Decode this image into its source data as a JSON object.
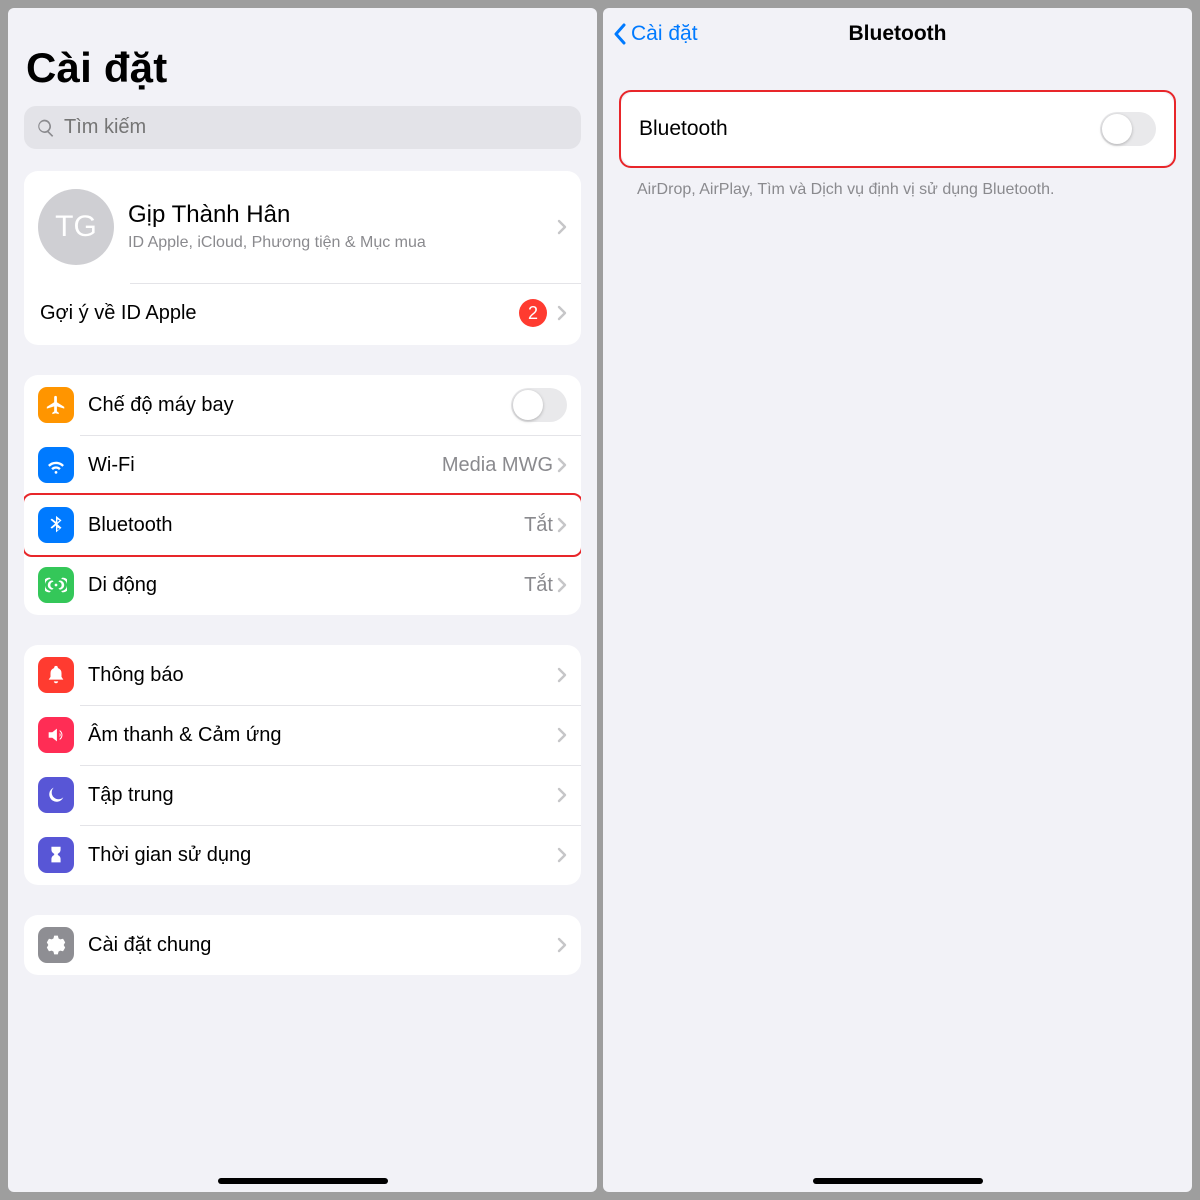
{
  "left": {
    "title": "Cài đặt",
    "search_placeholder": "Tìm kiếm",
    "profile": {
      "initials": "TG",
      "name": "Gịp Thành Hân",
      "subtitle": "ID Apple, iCloud, Phương tiện & Mục mua"
    },
    "suggestion": {
      "label": "Gợi ý về ID Apple",
      "badge": "2"
    },
    "group1": {
      "airplane": "Chế độ máy bay",
      "wifi_label": "Wi-Fi",
      "wifi_value": "Media MWG",
      "bluetooth_label": "Bluetooth",
      "bluetooth_value": "Tắt",
      "cellular_label": "Di động",
      "cellular_value": "Tắt"
    },
    "group2": {
      "notifications": "Thông báo",
      "sounds": "Âm thanh & Cảm ứng",
      "focus": "Tập trung",
      "screentime": "Thời gian sử dụng"
    },
    "group3": {
      "general": "Cài đặt chung"
    }
  },
  "right": {
    "back_label": "Cài đặt",
    "title": "Bluetooth",
    "toggle_label": "Bluetooth",
    "footer": "AirDrop, AirPlay, Tìm và Dịch vụ định vị sử dụng Bluetooth."
  }
}
